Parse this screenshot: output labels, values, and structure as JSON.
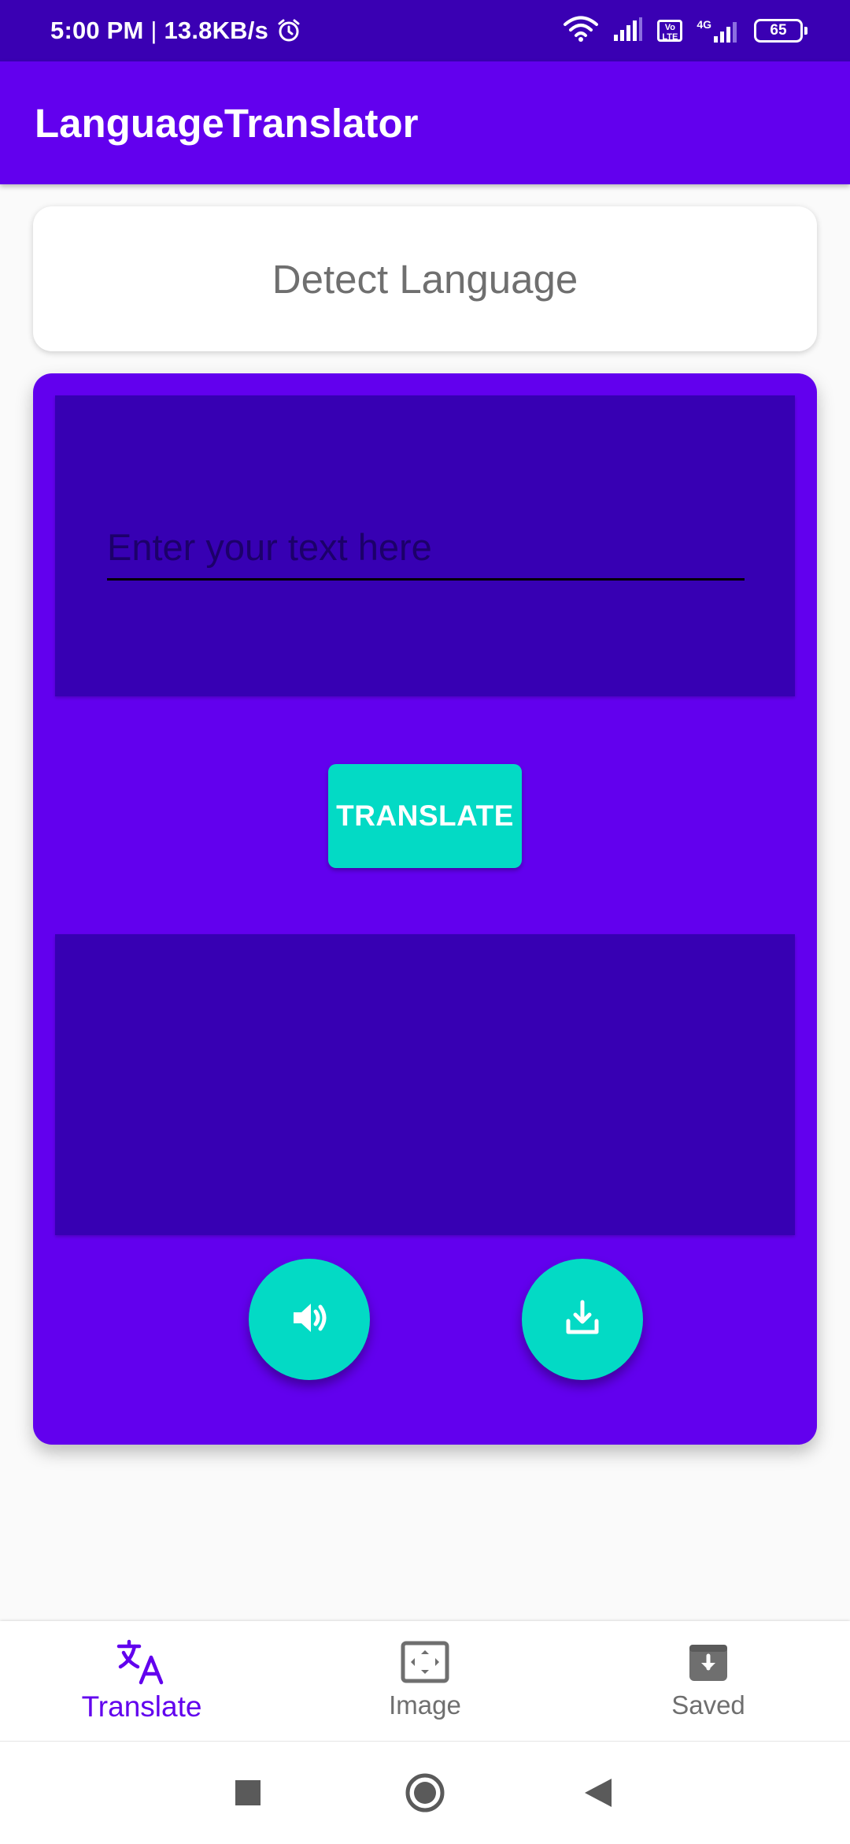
{
  "status_bar": {
    "time": "5:00 PM",
    "separator": " | ",
    "net_speed": "13.8KB/s",
    "network_type": "4G",
    "volte_label": "Vo LTE",
    "battery": "65",
    "icons": [
      "alarm-icon",
      "wifi-icon",
      "signal-icon",
      "volte-icon",
      "signal-4g-icon",
      "battery-icon"
    ]
  },
  "app_bar": {
    "title": "LanguageTranslator"
  },
  "detect": {
    "label": "Detect Language"
  },
  "translator": {
    "input_value": "",
    "input_placeholder": "Enter your text here",
    "translate_label": "TRANSLATE",
    "output_text": "",
    "speak_icon": "volume-icon",
    "save_icon": "download-icon"
  },
  "bottom_nav": {
    "items": [
      {
        "label": "Translate",
        "icon": "translate-icon",
        "active": true
      },
      {
        "label": "Image",
        "icon": "image-scan-icon",
        "active": false
      },
      {
        "label": "Saved",
        "icon": "archive-icon",
        "active": false
      }
    ]
  },
  "system_nav": {
    "icons": [
      "recent-apps-icon",
      "home-icon",
      "back-icon"
    ]
  },
  "colors": {
    "status_bar": "#3a00b3",
    "primary": "#6200ee",
    "primary_dark": "#3700b3",
    "accent": "#03dac5",
    "background": "#fafafa",
    "inactive_text": "#6f6f6f"
  }
}
